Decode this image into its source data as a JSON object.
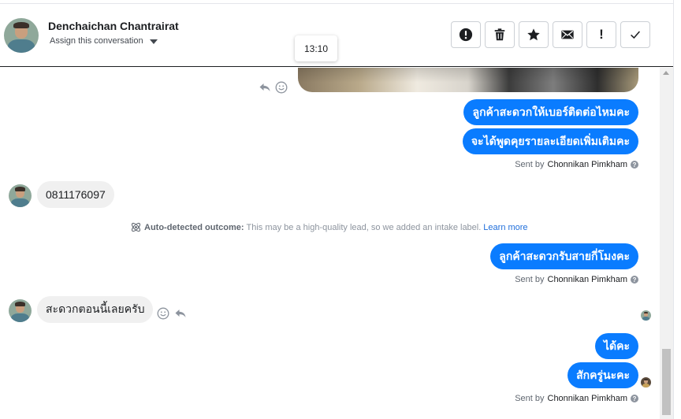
{
  "header": {
    "contact_name": "Denchaichan Chantrairat",
    "assign_label": "Assign this conversation",
    "time_tooltip": "13:10",
    "actions": [
      {
        "name": "mark-spam-button",
        "icon": "alert-circle-icon"
      },
      {
        "name": "delete-button",
        "icon": "trash-icon"
      },
      {
        "name": "star-button",
        "icon": "star-icon"
      },
      {
        "name": "mark-unread-button",
        "icon": "envelope-icon"
      },
      {
        "name": "follow-up-button",
        "icon": "exclamation-icon",
        "glyph": "!"
      },
      {
        "name": "mark-done-button",
        "icon": "checkmark-icon"
      }
    ]
  },
  "thread": {
    "messages_out_1": [
      "ลูกค้าสะดวกให้เบอร์ติดต่อไหมคะ",
      "จะได้พูดคุยรายละเอียดเพิ่มเติมคะ"
    ],
    "sent_by_prefix": "Sent by",
    "agent_name": "Chonnikan Pimkham",
    "customer_message_1": "0811176097",
    "auto_outcome": {
      "title": "Auto-detected outcome:",
      "text": "This may be a high-quality lead, so we added an intake label.",
      "link": "Learn more"
    },
    "messages_out_2": [
      "ลูกค้าสะดวกรับสายกี่โมงคะ"
    ],
    "customer_message_2": "สะดวกตอนนี้เลยครับ",
    "messages_out_3": [
      "ได้คะ",
      "สักครู่นะคะ"
    ]
  },
  "colors": {
    "outgoing_bubble": "#0a7cff",
    "incoming_bubble": "#f0f0f0",
    "link": "#216fdb"
  }
}
